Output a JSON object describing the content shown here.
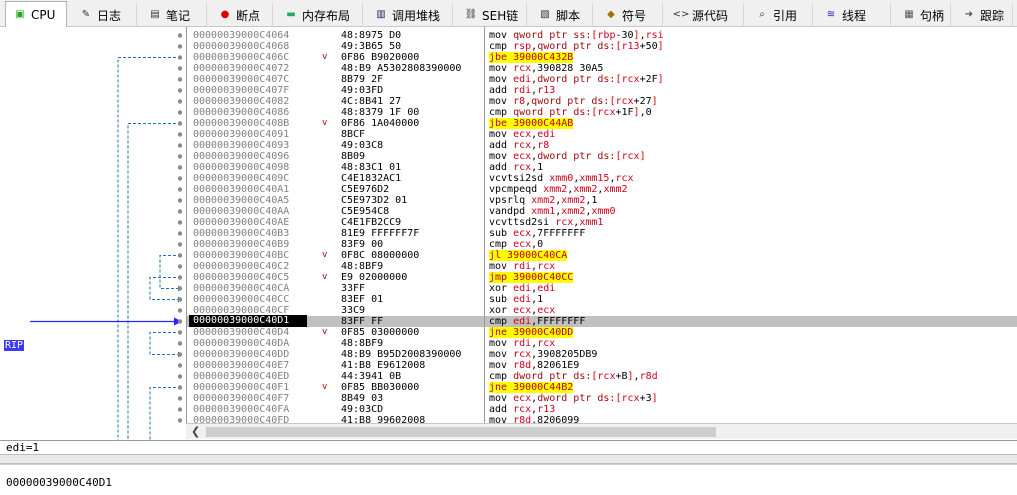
{
  "tabs": [
    {
      "label": "CPU",
      "icon": "cpu-icon",
      "active": true
    },
    {
      "label": "日志",
      "icon": "log-icon"
    },
    {
      "label": "笔记",
      "icon": "notes-icon"
    },
    {
      "label": "断点",
      "icon": "breakpoint-icon"
    },
    {
      "label": "内存布局",
      "icon": "memory-map-icon"
    },
    {
      "label": "调用堆栈",
      "icon": "call-stack-icon"
    },
    {
      "label": "SEH链",
      "icon": "seh-chain-icon"
    },
    {
      "label": "脚本",
      "icon": "script-icon"
    },
    {
      "label": "符号",
      "icon": "symbols-icon"
    },
    {
      "label": "源代码",
      "icon": "source-icon"
    },
    {
      "label": "引用",
      "icon": "references-icon"
    },
    {
      "label": "线程",
      "icon": "threads-icon"
    },
    {
      "label": "句柄",
      "icon": "handles-icon"
    },
    {
      "label": "跟踪",
      "icon": "trace-icon"
    }
  ],
  "rip_label": "RIP",
  "current_address": "00000039000C40D1",
  "rows": [
    {
      "addr": "00000039000C4064",
      "marker": "",
      "bytes": "48:8975 D0",
      "instr": "mov qword ptr ss:[rbp-30],rsi"
    },
    {
      "addr": "00000039000C4068",
      "marker": "",
      "bytes": "49:3B65 50",
      "instr": "cmp rsp,qword ptr ds:[r13+50]"
    },
    {
      "addr": "00000039000C406C",
      "marker": "v",
      "bytes": "0F86 B9020000",
      "instr": "jbe 39000C432B",
      "jump": true
    },
    {
      "addr": "00000039000C4072",
      "marker": "",
      "bytes": "48:B9 A5302808390000",
      "instr": "mov rcx,390828 30A5"
    },
    {
      "addr": "00000039000C407C",
      "marker": "",
      "bytes": "8B79 2F",
      "instr": "mov edi,dword ptr ds:[rcx+2F]"
    },
    {
      "addr": "00000039000C407F",
      "marker": "",
      "bytes": "49:03FD",
      "instr": "add rdi,r13"
    },
    {
      "addr": "00000039000C4082",
      "marker": "",
      "bytes": "4C:8B41 27",
      "instr": "mov r8,qword ptr ds:[rcx+27]"
    },
    {
      "addr": "00000039000C4086",
      "marker": "",
      "bytes": "48:8379 1F 00",
      "instr": "cmp qword ptr ds:[rcx+1F],0"
    },
    {
      "addr": "00000039000C408B",
      "marker": "v",
      "bytes": "0F86 1A040000",
      "instr": "jbe 39000C44AB",
      "jump": true
    },
    {
      "addr": "00000039000C4091",
      "marker": "",
      "bytes": "8BCF",
      "instr": "mov ecx,edi"
    },
    {
      "addr": "00000039000C4093",
      "marker": "",
      "bytes": "49:03C8",
      "instr": "add rcx,r8"
    },
    {
      "addr": "00000039000C4096",
      "marker": "",
      "bytes": "8B09",
      "instr": "mov ecx,dword ptr ds:[rcx]"
    },
    {
      "addr": "00000039000C4098",
      "marker": "",
      "bytes": "48:83C1 01",
      "instr": "add rcx,1"
    },
    {
      "addr": "00000039000C409C",
      "marker": "",
      "bytes": "C4E1832AC1",
      "instr": "vcvtsi2sd xmm0,xmm15,rcx"
    },
    {
      "addr": "00000039000C40A1",
      "marker": "",
      "bytes": "C5E976D2",
      "instr": "vpcmpeqd xmm2,xmm2,xmm2"
    },
    {
      "addr": "00000039000C40A5",
      "marker": "",
      "bytes": "C5E973D2 01",
      "instr": "vpsrlq xmm2,xmm2,1"
    },
    {
      "addr": "00000039000C40AA",
      "marker": "",
      "bytes": "C5E954C8",
      "instr": "vandpd xmm1,xmm2,xmm0"
    },
    {
      "addr": "00000039000C40AE",
      "marker": "",
      "bytes": "C4E1FB2CC9",
      "instr": "vcvttsd2si rcx,xmm1"
    },
    {
      "addr": "00000039000C40B3",
      "marker": "",
      "bytes": "81E9 FFFFFF7F",
      "instr": "sub ecx,7FFFFFFF"
    },
    {
      "addr": "00000039000C40B9",
      "marker": "",
      "bytes": "83F9 00",
      "instr": "cmp ecx,0"
    },
    {
      "addr": "00000039000C40BC",
      "marker": "v",
      "bytes": "0F8C 08000000",
      "instr": "jl 39000C40CA",
      "jump": true
    },
    {
      "addr": "00000039000C40C2",
      "marker": "",
      "bytes": "48:8BF9",
      "instr": "mov rdi,rcx"
    },
    {
      "addr": "00000039000C40C5",
      "marker": "v",
      "bytes": "E9 02000000",
      "instr": "jmp 39000C40CC",
      "jump": true
    },
    {
      "addr": "00000039000C40CA",
      "marker": "",
      "bytes": "33FF",
      "instr": "xor edi,edi"
    },
    {
      "addr": "00000039000C40CC",
      "marker": "",
      "bytes": "83EF 01",
      "instr": "sub edi,1"
    },
    {
      "addr": "00000039000C40CF",
      "marker": "",
      "bytes": "33C9",
      "instr": "xor ecx,ecx"
    },
    {
      "addr": "00000039000C40D1",
      "marker": "",
      "bytes": "83FF FF",
      "instr": "cmp edi,FFFFFFFF",
      "current": true
    },
    {
      "addr": "00000039000C40D4",
      "marker": "v",
      "bytes": "0F85 03000000",
      "instr": "jne 39000C40DD",
      "jump": true
    },
    {
      "addr": "00000039000C40DA",
      "marker": "",
      "bytes": "48:8BF9",
      "instr": "mov rdi,rcx"
    },
    {
      "addr": "00000039000C40DD",
      "marker": "",
      "bytes": "48:B9 B95D2008390000",
      "instr": "mov rcx,3908205DB9"
    },
    {
      "addr": "00000039000C40E7",
      "marker": "",
      "bytes": "41:B8 E9612008",
      "instr": "mov r8d,82061E9"
    },
    {
      "addr": "00000039000C40ED",
      "marker": "",
      "bytes": "44:3941 0B",
      "instr": "cmp dword ptr ds:[rcx+B],r8d"
    },
    {
      "addr": "00000039000C40F1",
      "marker": "v",
      "bytes": "0F85 BB030000",
      "instr": "jne 39000C44B2",
      "jump": true
    },
    {
      "addr": "00000039000C40F7",
      "marker": "",
      "bytes": "8B49 03",
      "instr": "mov ecx,dword ptr ds:[rcx+3]"
    },
    {
      "addr": "00000039000C40FA",
      "marker": "",
      "bytes": "49:03CD",
      "instr": "add rcx,r13"
    },
    {
      "addr": "00000039000C40FD",
      "marker": "",
      "bytes": "41:B8 99602008",
      "instr": "mov r8d,8206099"
    }
  ],
  "status_line": "edi=1",
  "status_address": "00000039000C40D1",
  "colors": {
    "accent": "#3a3aff",
    "jump_highlight": "#ffff00",
    "register": "#d0001a",
    "current_row": "#c0c0c0"
  }
}
